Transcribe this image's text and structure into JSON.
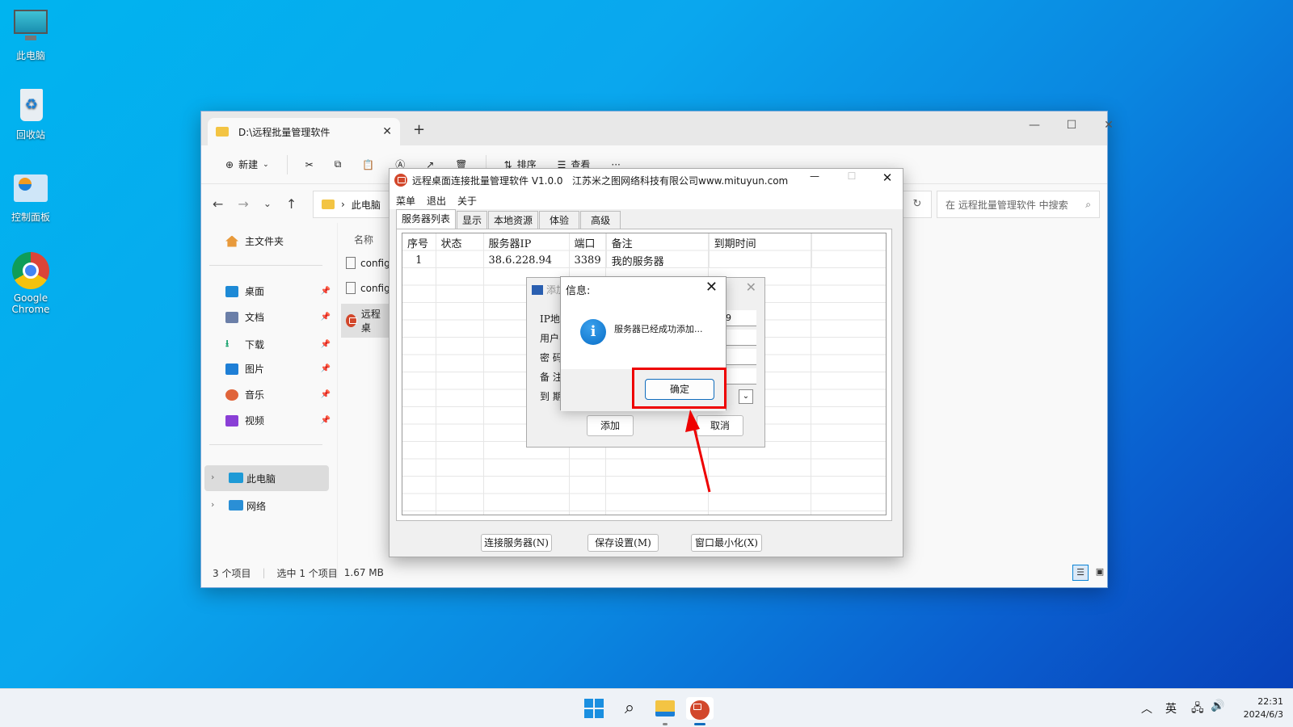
{
  "desktop": {
    "icons": [
      {
        "label": "此电脑",
        "icon": "monitor-icon"
      },
      {
        "label": "回收站",
        "icon": "recycle-bin-icon"
      },
      {
        "label": "控制面板",
        "icon": "control-panel-icon"
      },
      {
        "label": "Google Chrome",
        "icon": "chrome-icon"
      }
    ]
  },
  "explorer": {
    "tab_title": "D:\\远程批量管理软件",
    "toolbar": {
      "new_label": "新建",
      "sort_label": "排序",
      "view_label": "查看",
      "more": "···"
    },
    "address": {
      "crumb": "此电脑",
      "sep": "›"
    },
    "search_placeholder": "在 远程批量管理软件 中搜索",
    "nav": {
      "home": "主文件夹",
      "quick": [
        {
          "label": "桌面",
          "color": "#1e8ad6"
        },
        {
          "label": "文档",
          "color": "#6b7fa8"
        },
        {
          "label": "下载",
          "color": "#1aa36f"
        },
        {
          "label": "图片",
          "color": "#1e7fd6"
        },
        {
          "label": "音乐",
          "color": "#e0643a"
        },
        {
          "label": "视频",
          "color": "#8a3fd6"
        }
      ],
      "this_pc": "此电脑",
      "network": "网络"
    },
    "files": {
      "header": "名称",
      "items": [
        "config",
        "config",
        "远程桌"
      ]
    },
    "status": {
      "count": "3 个项目",
      "selected": "选中 1 个项目",
      "size": "1.67 MB"
    }
  },
  "app": {
    "title": "远程桌面连接批量管理软件 V1.0.0   江苏米之图网络科技有限公司www.mituyun.com",
    "menu": [
      "菜单",
      "退出",
      "关于"
    ],
    "tabs": [
      "服务器列表",
      "显示",
      "本地资源",
      "体验",
      "高级"
    ],
    "columns": [
      "序号",
      "状态",
      "服务器IP",
      "端口",
      "备注",
      "到期时间"
    ],
    "rows": [
      {
        "index": "1",
        "status": "",
        "ip": "38.6.228.94",
        "port": "3389",
        "note": "我的服务器",
        "expiry": ""
      }
    ],
    "buttons": {
      "connect": "连接服务器(N)",
      "save": "保存设置(M)",
      "minimize": "窗口最小化(X)"
    }
  },
  "add_dialog": {
    "title": "添加",
    "labels": [
      "IP地址",
      "用户名",
      "密  码",
      "备  注",
      "到  期"
    ],
    "ip_value_tail": "9",
    "add_label": "添加",
    "cancel_label": "取消"
  },
  "info_dialog": {
    "title": "信息:",
    "message": "服务器已经成功添加...",
    "ok_label": "确定"
  },
  "annotation": {
    "color": "#e00000"
  },
  "taskbar": {
    "ime": "英",
    "time": "22:31",
    "date": "2024/6/3"
  }
}
